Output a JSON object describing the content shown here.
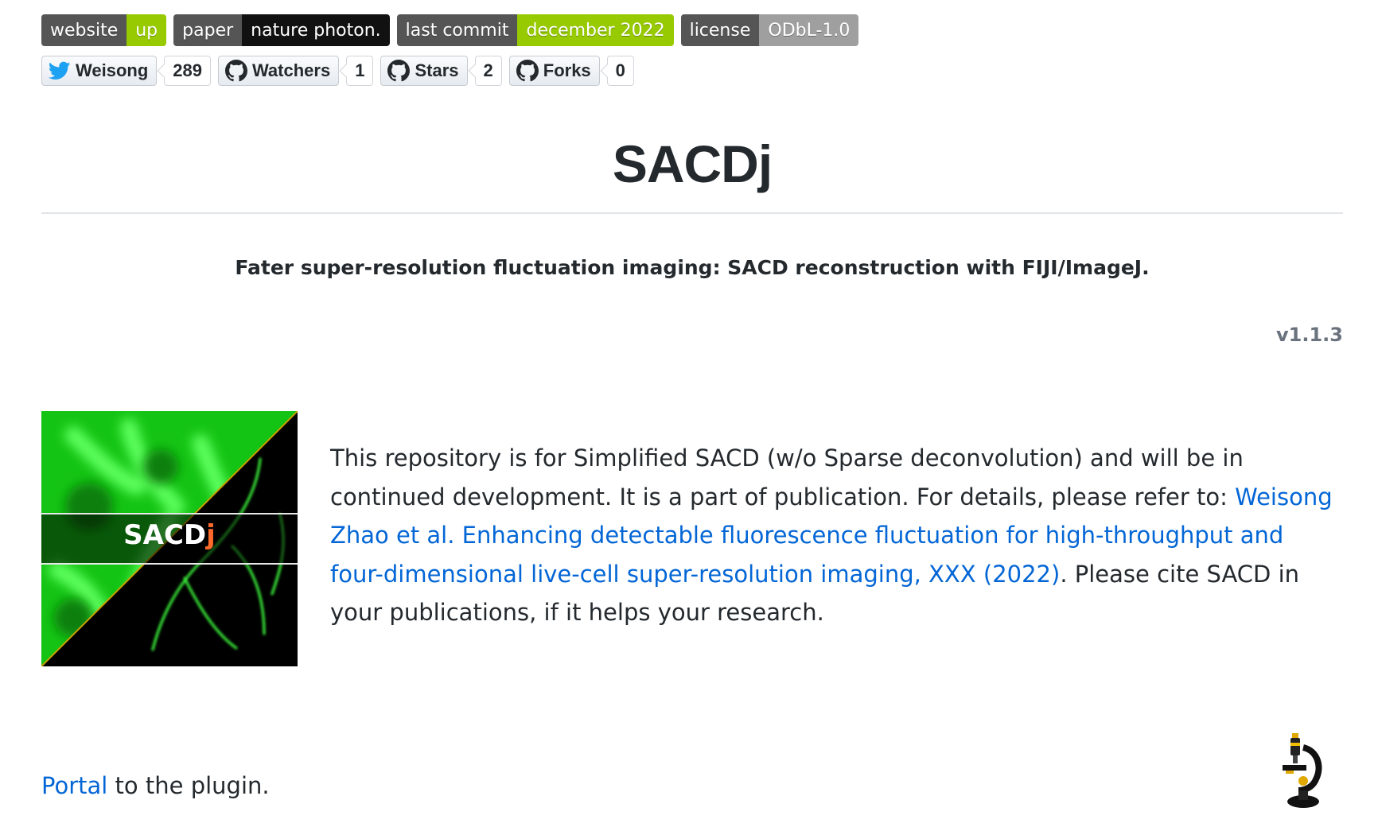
{
  "badges": [
    {
      "label": "website",
      "message": "up",
      "color": "#97ca00"
    },
    {
      "label": "paper",
      "message": "nature photon.",
      "color": "#111111"
    },
    {
      "label": "last commit",
      "message": "december 2022",
      "color": "#97ca00"
    },
    {
      "label": "license",
      "message": "ODbL-1.0",
      "color": "#9f9f9f"
    }
  ],
  "social": {
    "twitter": {
      "label": "Weisong",
      "count": "289",
      "icon": "twitter-bird-icon"
    },
    "watchers": {
      "label": "Watchers",
      "count": "1",
      "icon": "github-icon"
    },
    "stars": {
      "label": "Stars",
      "count": "2",
      "icon": "github-icon"
    },
    "forks": {
      "label": "Forks",
      "count": "0",
      "icon": "github-icon"
    }
  },
  "title": "SACDj",
  "subtitle": "Fater super-resolution fluctuation imaging: SACD reconstruction with FIJI/ImageJ.",
  "version": "v1.1.3",
  "logo": {
    "text": "SACD",
    "text_j": "j"
  },
  "paragraph": {
    "before_link": "This repository is for Simplified SACD (w/o Sparse deconvolution) and will be in continued development. It is a part of publication. For details, please refer to: ",
    "link": "Weisong Zhao et al. Enhancing detectable fluorescence fluctuation for high-throughput and four-dimensional live-cell super-resolution imaging, XXX (2022)",
    "after_link": ". Please cite SACD in your publications, if it helps your research."
  },
  "portal": {
    "link": "Portal",
    "rest": " to the plugin."
  },
  "colors": {
    "link": "#0366d6",
    "text": "#24292e",
    "green": "#97ca00"
  }
}
